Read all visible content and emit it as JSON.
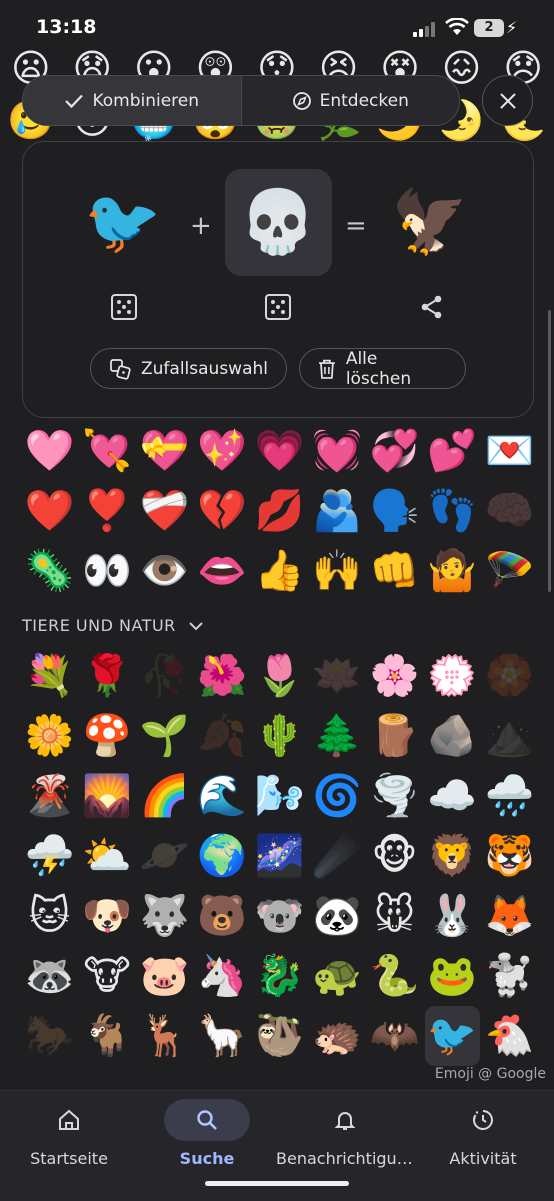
{
  "status": {
    "time": "13:18",
    "battery": "2"
  },
  "top_rows": [
    [
      "😦",
      "😧",
      "😮",
      "😲",
      "😯",
      "😣",
      "😵",
      "😖",
      "😞"
    ],
    [
      "🥲",
      "😳",
      "🥶",
      "🤯",
      "🤢",
      "🌿",
      "🌙",
      "🌛",
      "🌜"
    ]
  ],
  "toolbar": {
    "combine_label": "Kombinieren",
    "discover_label": "Entdecken"
  },
  "mixer": {
    "left": "🐦",
    "middle": "💀",
    "result": "🦅",
    "plus": "+",
    "equals": "=",
    "random_label": "Zufallsauswahl",
    "clear_label": "Alle löschen"
  },
  "emoji_grid_top": [
    "🩷",
    "💘",
    "💝",
    "💖",
    "💗",
    "💓",
    "💞",
    "💕",
    "💌",
    "❤️",
    "❣️",
    "❤️‍🩹",
    "💔",
    "💋",
    "🫂",
    "🗣️",
    "👣",
    "🧠",
    "🦠",
    "👀",
    "👁️",
    "👄",
    "👍",
    "🙌",
    "👊",
    "🤷",
    "🪂"
  ],
  "section": {
    "title": "TIERE UND NATUR"
  },
  "emoji_grid_nature": [
    "💐",
    "🌹",
    "🥀",
    "🌺",
    "🌷",
    "🪷",
    "🌸",
    "💮",
    "🏵️",
    "🌼",
    "🍄",
    "🌱",
    "🍂",
    "🌵",
    "🌲",
    "🪵",
    "🪨",
    "⛰️",
    "🌋",
    "🌄",
    "🌈",
    "🌊",
    "🌬️",
    "🌀",
    "🌪️",
    "☁️",
    "🌧️",
    "⛈️",
    "⛅",
    "🪐",
    "🌍",
    "🌌",
    "☄️",
    "🐵",
    "🦁",
    "🐯",
    "🐱",
    "🐶",
    "🐺",
    "🐻",
    "🐨",
    "🐼",
    "🐭",
    "🐰",
    "🦊",
    "🦝",
    "🐮",
    "🐷",
    "🦄",
    "🐉",
    "🐢",
    "🐍",
    "🐸",
    "🐩",
    "🐎",
    "🐐",
    "🦌",
    "🦙",
    "🦥",
    "🦔",
    "🦇",
    "🐦",
    "🐔"
  ],
  "credit": "Emoji @ Google",
  "nav": {
    "home": "Startseite",
    "search": "Suche",
    "notifications": "Benachrichtigungen",
    "activity": "Aktivität"
  }
}
